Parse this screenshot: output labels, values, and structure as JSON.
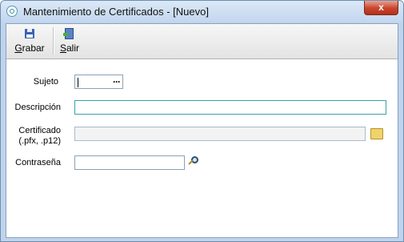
{
  "window": {
    "title": "Mantenimiento de Certificados - [Nuevo]",
    "close_label": "x"
  },
  "toolbar": {
    "save_label_underlined": "G",
    "save_label_rest": "rabar",
    "exit_label_underlined": "S",
    "exit_label_rest": "alir"
  },
  "form": {
    "subject_label": "Sujeto",
    "subject_value": "",
    "subject_button": "···",
    "description_label": "Descripción",
    "description_value": "",
    "certificate_label_line1": "Certificado",
    "certificate_label_line2": "(.pfx, .p12)",
    "certificate_value": "",
    "password_label": "Contraseña",
    "password_value": ""
  },
  "icons": {
    "app": "app-logo-icon",
    "save": "floppy-disk-icon",
    "exit": "exit-door-icon",
    "browse": "folder-search-icon",
    "search": "magnifier-icon"
  },
  "colors": {
    "title_bar": "#c3d6ee",
    "close_button": "#c9442c",
    "active_field_border": "#3da0a6"
  }
}
